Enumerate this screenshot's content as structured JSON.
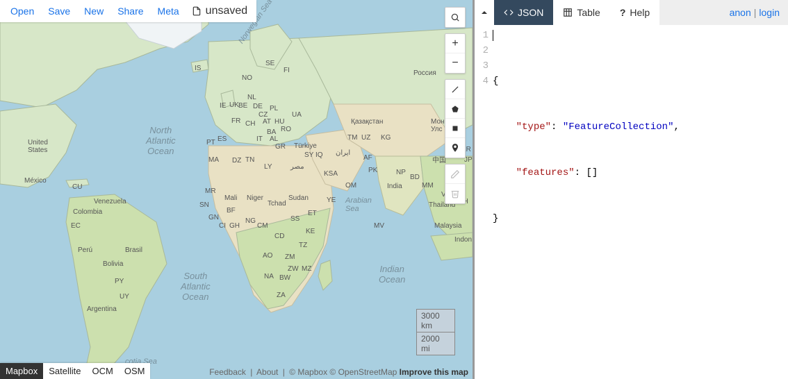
{
  "file_menu": {
    "items": [
      "Open",
      "Save",
      "New",
      "Share",
      "Meta"
    ],
    "doc_status": "unsaved"
  },
  "map_controls": {
    "search_tooltip": "Search",
    "zoom_in": "+",
    "zoom_out": "−"
  },
  "scale": {
    "metric": "3000 km",
    "imperial": "2000 mi"
  },
  "layers": [
    "Mapbox",
    "Satellite",
    "OCM",
    "OSM"
  ],
  "active_layer": "Mapbox",
  "attribution": {
    "feedback": "Feedback",
    "about": "About",
    "copyright": "© Mapbox © OpenStreetMap",
    "improve": "Improve this map"
  },
  "tabs": {
    "json": "JSON",
    "table": "Table",
    "help": "Help"
  },
  "active_tab": "JSON",
  "account": {
    "anon": "anon",
    "login": "login"
  },
  "code": {
    "line1": "{",
    "line2_indent": "    ",
    "line2_key": "\"type\"",
    "line2_colon": ": ",
    "line2_val": "\"FeatureCollection\"",
    "line2_end": ",",
    "line3_indent": "    ",
    "line3_key": "\"features\"",
    "line3_colon": ": ",
    "line3_val": "[]",
    "line4": "}"
  },
  "gutter": [
    "1",
    "2",
    "3",
    "4"
  ],
  "map_labels": {
    "north_atlantic": "North\nAtlantic\nOcean",
    "south_atlantic": "South\nAtlantic\nOcean",
    "indian_ocean": "Indian\nOcean",
    "arabian_sea": "Arabian\nSea",
    "norwegian_sea": "Norwegian Sea",
    "scotia_sea": "cotia Sea",
    "russia": "Россия",
    "kazakhstan": "Қазақстан",
    "mongolia": "Монгол\nУлс",
    "china_cn": "中国",
    "turkey": "Türkiye",
    "us": "United\nStates",
    "mexico": "México",
    "cuba": "CU",
    "venezuela": "Venezuela",
    "colombia": "Colombia",
    "ecuador": "EC",
    "peru": "Perú",
    "bolivia": "Bolivia",
    "brasil": "Brasil",
    "argentina": "Argentina",
    "paraguay": "PY",
    "uruguay": "UY",
    "india": "India",
    "thailand": "Thailand",
    "malaysia": "Malaysia",
    "indonesia": "Indon",
    "niger": "Niger",
    "mali": "Mali",
    "sudan": "Sudan",
    "egypt": "مصر",
    "iran": "ایران",
    "ksa": "KSA",
    "al": "AL",
    "ba": "BA",
    "at": "AT",
    "ch": "CH",
    "be": "BE",
    "cz": "CZ",
    "de": "DE",
    "es": "ES",
    "fi": "FI",
    "fr": "FR",
    "ie": "IE",
    "is": "IS",
    "it": "IT",
    "no": "NO",
    "pl": "PL",
    "pt": "PT",
    "se": "SE",
    "uk": "UK",
    "ua": "UA",
    "ro": "RO",
    "hu": "HU",
    "gr": "GR",
    "nl": "NL",
    "dz": "DZ",
    "ly": "LY",
    "ma": "MA",
    "mr": "MR",
    "sn": "SN",
    "tn": "TN",
    "bf": "BF",
    "ci": "CI",
    "gh": "GH",
    "gn": "GN",
    "ng": "NG",
    "tchad": "Tchad",
    "cm": "CM",
    "cd": "CD",
    "ss": "SS",
    "et": "ET",
    "ke": "KE",
    "tz": "TZ",
    "ao": "AO",
    "zm": "ZM",
    "zw": "ZW",
    "mz": "MZ",
    "na": "NA",
    "bw": "BW",
    "za": "ZA",
    "mv": "MV",
    "af": "AF",
    "pk": "PK",
    "tm": "TM",
    "uz": "UZ",
    "kg": "KG",
    "np": "NP",
    "bd": "BD",
    "mm": "MM",
    "vn": "VN",
    "ph": "PH",
    "iq": "IQ",
    "sy": "SY",
    "ye": "YE",
    "om": "OM",
    "jp": "JP",
    "kr": "KR"
  }
}
